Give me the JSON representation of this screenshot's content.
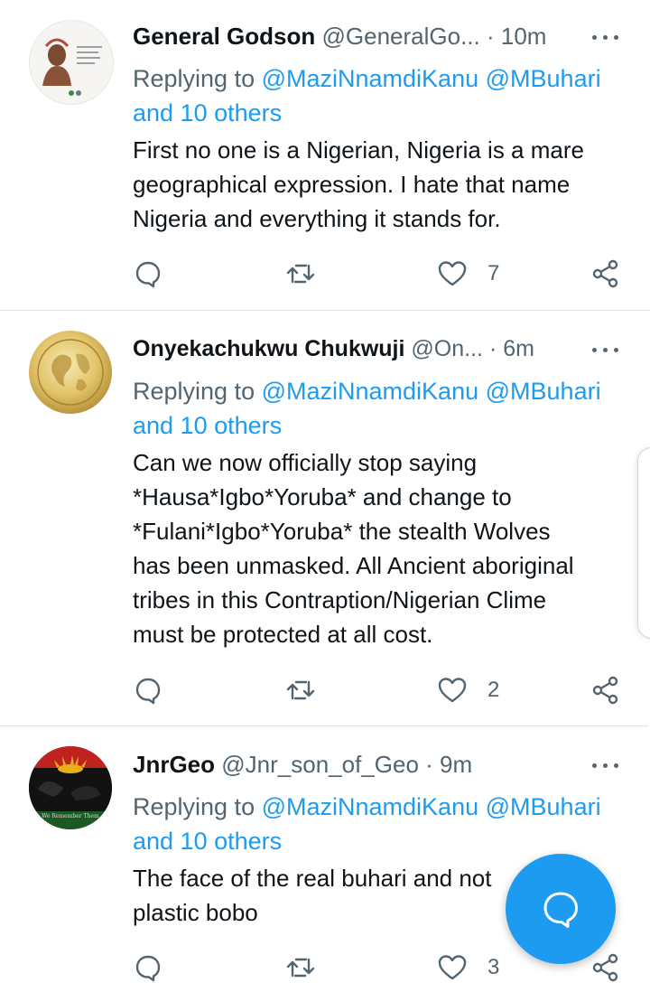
{
  "colors": {
    "accent": "#1d9bf0",
    "text": "#0f1419",
    "muted": "#536471"
  },
  "tweets": [
    {
      "avatar_icon": "profile-photo-icon",
      "name": "General Godson",
      "handle": "@GeneralGo...",
      "time": "· 10m",
      "replying_prefix": "Replying to ",
      "mention_1": "@MaziNnamdiKanu",
      "mention_2": "@MBuhari",
      "others": "and 10 others",
      "text_lines": [
        "First no one is a Nigerian,  Nigeria is a mare",
        "geographical expression.  I hate that name",
        "Nigeria and everything it stands for."
      ],
      "like_count": "7"
    },
    {
      "avatar_icon": "golden-globe-icon",
      "name": "Onyekachukwu Chukwuji",
      "handle": "@On...",
      "time": "· 6m",
      "replying_prefix": "Replying to ",
      "mention_1": "@MaziNnamdiKanu",
      "mention_2": "@MBuhari",
      "others": "and 10 others",
      "text_lines": [
        "Can we now officially stop saying",
        "*Hausa*Igbo*Yoruba*  and change to",
        "*Fulani*Igbo*Yoruba* the stealth Wolves",
        "has been unmasked. All Ancient aboriginal",
        "tribes in this Contraption/Nigerian Clime",
        "must be protected at all cost."
      ],
      "like_count": "2"
    },
    {
      "avatar_icon": "biafra-sun-icon",
      "avatar_caption": "We Remember Them",
      "name": "JnrGeo",
      "handle": "@Jnr_son_of_Geo",
      "time": "· 9m",
      "replying_prefix": "Replying to ",
      "mention_1": "@MaziNnamdiKanu",
      "mention_2": "@MBuhari",
      "others": "and 10 others",
      "text_lines": [
        "The face of the real buhari and not",
        "plastic bobo"
      ],
      "like_count": "3"
    }
  ],
  "fab": {
    "icon": "compose-reply-icon"
  }
}
